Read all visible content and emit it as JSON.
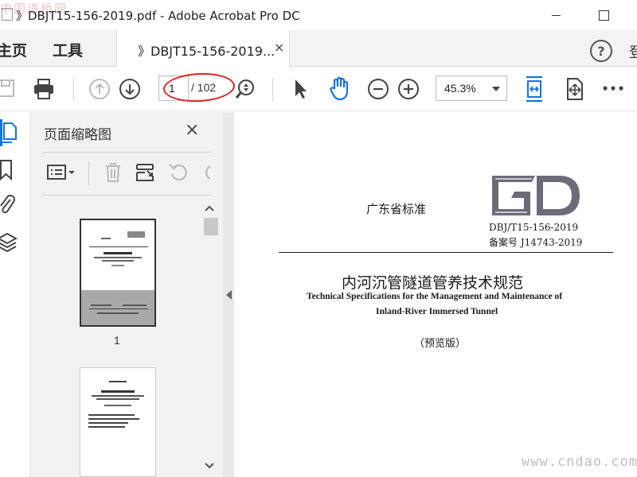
{
  "window": {
    "title": "》DBJT15-156-2019.pdf - Adobe Acrobat Pro DC",
    "watermark_top": "中国道桥网"
  },
  "nav": {
    "home": "主页",
    "tools": "工具",
    "login_partial": "登"
  },
  "doc_tab": {
    "label": "》DBJT15-156-2019...",
    "close": "×"
  },
  "toolbar": {
    "page_current": "1",
    "page_total": "/ 102",
    "zoom": "45.3%"
  },
  "thumbnails": {
    "title": "页面缩略图",
    "close": "×",
    "page_label": "1"
  },
  "page": {
    "provincial_standard": "广东省标准",
    "std_code": "DBJ/T15-156-2019",
    "record_no": "备案号 J14743-2019",
    "title_cn": "内河沉管隧道管养技术规范",
    "title_en_line1": "Technical Specifications for the Management and Maintenance of",
    "title_en_line2": "Inland-River Immersed Tunnel",
    "edition": "（预览版）",
    "logo_text": "GD"
  },
  "watermark_bottom": "www.cndao.com",
  "colors": {
    "accent_blue": "#1473e6",
    "annotation_red": "#e02020",
    "logo_gray": "#6e6a7a"
  }
}
